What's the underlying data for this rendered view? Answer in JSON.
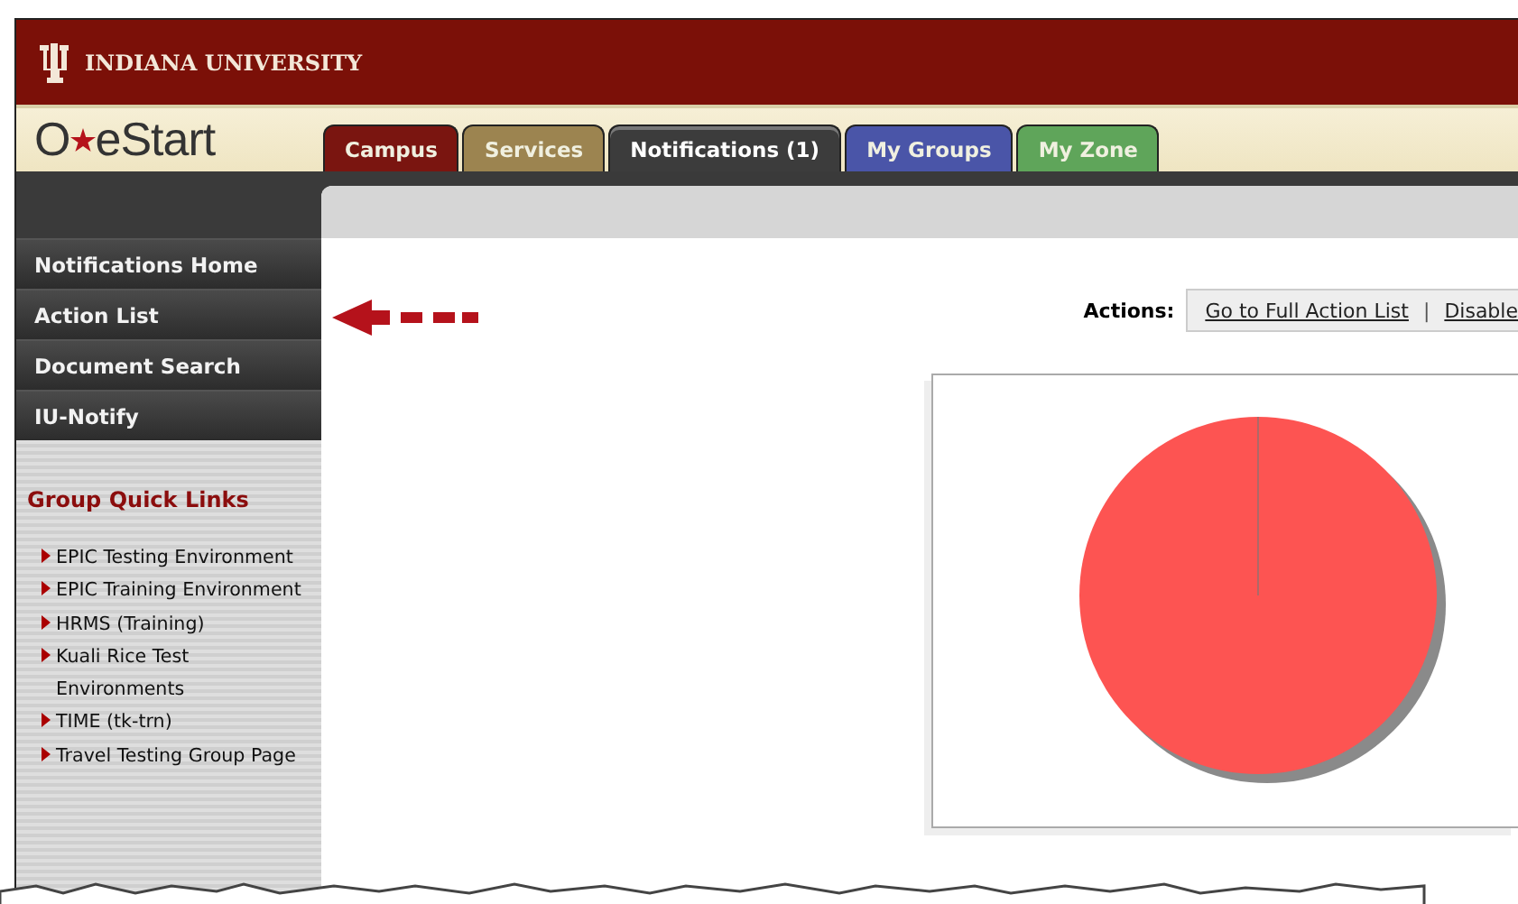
{
  "header": {
    "university": "INDIANA UNIVERSITY",
    "logo": {
      "left": "O",
      "right": "eStart"
    }
  },
  "tabs": [
    {
      "label": "Campus",
      "color": "#7a1510",
      "selected": false
    },
    {
      "label": "Services",
      "color": "#9c8450",
      "selected": false
    },
    {
      "label": "Notifications (1)",
      "color": "#3c3c3c",
      "selected": true
    },
    {
      "label": "My Groups",
      "color": "#4a55a8",
      "selected": false
    },
    {
      "label": "My Zone",
      "color": "#5fa55a",
      "selected": false
    }
  ],
  "sidebar": {
    "items": [
      {
        "label": "Notifications Home"
      },
      {
        "label": "Action List"
      },
      {
        "label": "Document Search"
      },
      {
        "label": "IU-Notify"
      }
    ],
    "quick_links_title": "Group Quick Links",
    "quick_links": [
      {
        "label": "EPIC Testing Environment"
      },
      {
        "label": "EPIC Training Environment"
      },
      {
        "label": "HRMS (Training)"
      },
      {
        "label": "Kuali Rice Test Environments"
      },
      {
        "label": "TIME (tk-trn)"
      },
      {
        "label": "Travel Testing Group Page"
      }
    ]
  },
  "actions": {
    "label": "Actions:",
    "links": [
      "Go to Full Action List",
      "Disable"
    ],
    "separator": "|"
  }
}
